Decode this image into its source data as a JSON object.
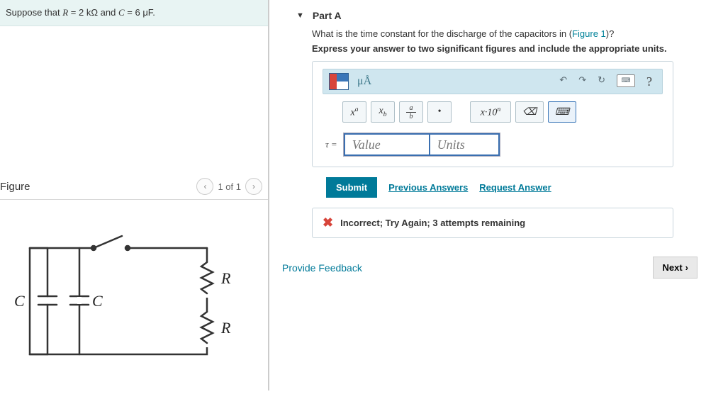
{
  "problem": {
    "suppose_html": "Suppose that <span class='math'>R</span> = 2 kΩ and <span class='math'>C</span> = 6 μF."
  },
  "figure": {
    "heading": "Figure",
    "page_of": "1 of 1",
    "labels": {
      "C": "C",
      "R": "R"
    }
  },
  "part": {
    "label": "Part A",
    "question_pre": "What is the time constant for the discharge of the capacitors in (",
    "figure_link": "Figure 1",
    "question_post": ")?",
    "instruction": "Express your answer to two significant figures and include the appropriate units."
  },
  "toolbar": {
    "mu_a": "μÅ",
    "xa": "xᵃ",
    "xb": "xᵦ",
    "frac_a": "a",
    "frac_b": "b",
    "dot": "•",
    "sci": "x·10ⁿ",
    "help": "?"
  },
  "answer": {
    "tau_label": "τ =",
    "value_placeholder": "Value",
    "units_placeholder": "Units"
  },
  "actions": {
    "submit": "Submit",
    "previous": "Previous Answers",
    "request": "Request Answer"
  },
  "feedback": {
    "text": "Incorrect; Try Again; 3 attempts remaining"
  },
  "footer": {
    "provide": "Provide Feedback",
    "next": "Next"
  }
}
